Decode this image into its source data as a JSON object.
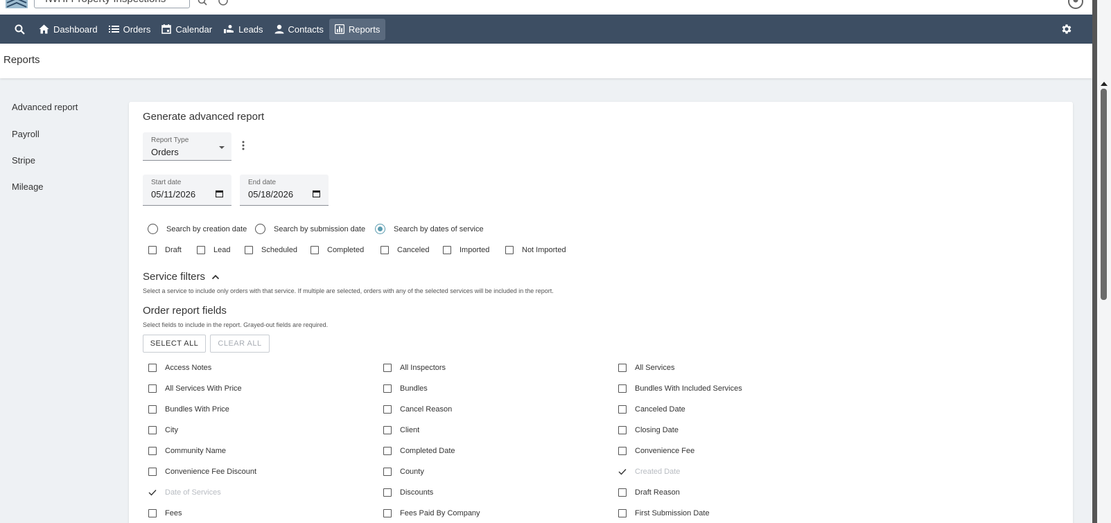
{
  "topbar": {
    "company_name": "IWHI Property Inspections",
    "icons": [
      "logo-icon",
      "search-icon",
      "help-icon",
      "account-icon"
    ]
  },
  "nav": {
    "items": [
      {
        "label": "Dashboard",
        "icon": "home-icon"
      },
      {
        "label": "Orders",
        "icon": "list-icon"
      },
      {
        "label": "Calendar",
        "icon": "calendar-icon"
      },
      {
        "label": "Leads",
        "icon": "leads-icon"
      },
      {
        "label": "Contacts",
        "icon": "person-icon"
      },
      {
        "label": "Reports",
        "icon": "chart-icon",
        "active": true
      }
    ],
    "settings_icon": "gear-icon",
    "bg_color": "#3d4e63",
    "active_color": "#5a6a7e"
  },
  "page": {
    "title": "Reports"
  },
  "sidebar": {
    "items": [
      {
        "label": "Advanced report"
      },
      {
        "label": "Payroll"
      },
      {
        "label": "Stripe"
      },
      {
        "label": "Mileage"
      }
    ]
  },
  "card": {
    "title": "Generate advanced report",
    "report_type": {
      "label": "Report Type",
      "value": "Orders"
    },
    "start_date": {
      "label": "Start date",
      "value": "05/11/2026"
    },
    "end_date": {
      "label": "End date",
      "value": "05/18/2026"
    },
    "search_by": [
      {
        "label": "Search by creation date",
        "checked": false
      },
      {
        "label": "Search by submission date",
        "checked": false
      },
      {
        "label": "Search by dates of service",
        "checked": true
      }
    ],
    "statuses": [
      {
        "label": "Draft"
      },
      {
        "label": "Lead"
      },
      {
        "label": "Scheduled"
      },
      {
        "label": "Completed"
      },
      {
        "label": "Canceled"
      },
      {
        "label": "Imported"
      },
      {
        "label": "Not Imported"
      }
    ],
    "service_filters": {
      "title": "Service filters",
      "hint": "Select a service to include only orders with that service. If multiple are selected, orders with any of the selected services will be included in the report."
    },
    "order_fields": {
      "title": "Order report fields",
      "hint": "Select fields to include in the report. Grayed-out fields are required.",
      "select_all": "SELECT ALL",
      "clear_all": "CLEAR ALL",
      "columns": [
        [
          {
            "label": "Access Notes"
          },
          {
            "label": "All Services With Price"
          },
          {
            "label": "Bundles With Price"
          },
          {
            "label": "City"
          },
          {
            "label": "Community Name"
          },
          {
            "label": "Convenience Fee Discount"
          },
          {
            "label": "Date of Services",
            "required": true
          },
          {
            "label": "Fees"
          }
        ],
        [
          {
            "label": "All Inspectors"
          },
          {
            "label": "Bundles"
          },
          {
            "label": "Cancel Reason"
          },
          {
            "label": "Client"
          },
          {
            "label": "Completed Date"
          },
          {
            "label": "County"
          },
          {
            "label": "Discounts"
          },
          {
            "label": "Fees Paid By Company"
          }
        ],
        [
          {
            "label": "All Services"
          },
          {
            "label": "Bundles With Included Services"
          },
          {
            "label": "Canceled Date"
          },
          {
            "label": "Closing Date"
          },
          {
            "label": "Convenience Fee"
          },
          {
            "label": "Created Date",
            "required": true
          },
          {
            "label": "Draft Reason"
          },
          {
            "label": "First Submission Date"
          }
        ]
      ]
    }
  }
}
